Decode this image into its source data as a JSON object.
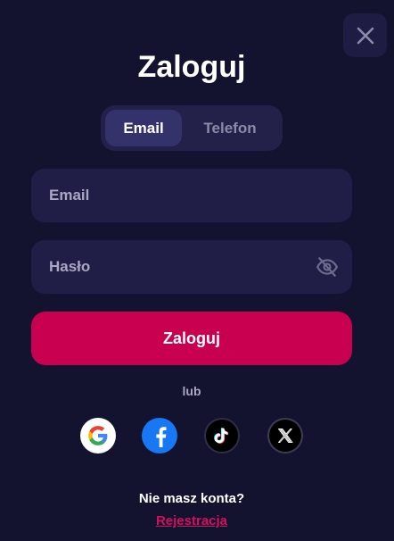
{
  "modal": {
    "title": "Zaloguj",
    "close_icon": "close-icon"
  },
  "tabs": [
    {
      "label": "Email",
      "active": true
    },
    {
      "label": "Telefon",
      "active": false
    }
  ],
  "form": {
    "email_placeholder": "Email",
    "email_value": "",
    "password_placeholder": "Hasło",
    "password_value": "",
    "password_toggle_icon": "eye-off-icon",
    "submit_label": "Zaloguj"
  },
  "social": {
    "divider_label": "lub",
    "providers": [
      {
        "name": "Google",
        "icon": "google-icon"
      },
      {
        "name": "Facebook",
        "icon": "facebook-icon"
      },
      {
        "name": "TikTok",
        "icon": "tiktok-icon"
      },
      {
        "name": "X",
        "icon": "x-icon"
      }
    ]
  },
  "footer": {
    "no_account_text": "Nie masz konta?",
    "register_link": "Rejestracja"
  },
  "colors": {
    "background": "#13122f",
    "field_background": "#201e46",
    "accent": "#c8004f",
    "link": "#d4105e"
  }
}
